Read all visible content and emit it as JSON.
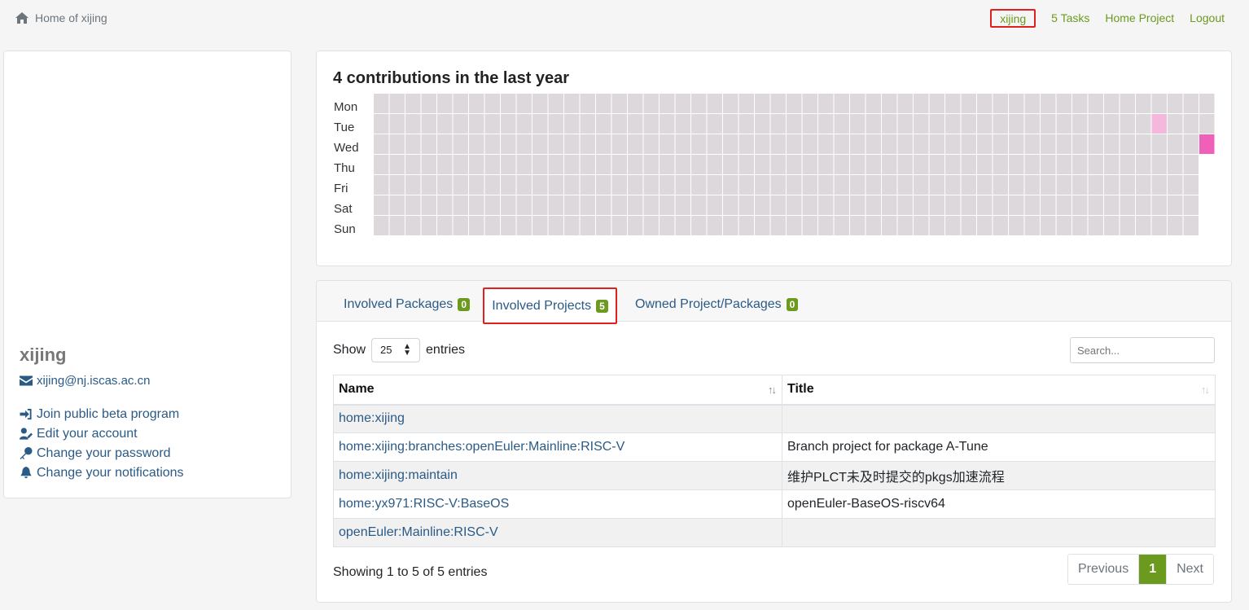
{
  "header": {
    "home_label": "Home of xijing",
    "nav": [
      "xijing",
      "5 Tasks",
      "Home Project",
      "Logout"
    ]
  },
  "profile": {
    "username": "xijing",
    "email": "xijing@nj.iscas.ac.cn",
    "actions": [
      "Join public beta program",
      "Edit your account",
      "Change your password",
      "Change your notifications"
    ]
  },
  "contributions": {
    "title": "4 contributions in the last year",
    "days": [
      "Mon",
      "Tue",
      "Wed",
      "Thu",
      "Fri",
      "Sat",
      "Sun"
    ],
    "colors": {
      "empty": "#ddd8dc",
      "light": "#f4b8dc",
      "dark": "#f060b8"
    }
  },
  "tabs": [
    {
      "label": "Involved Packages",
      "count": "0"
    },
    {
      "label": "Involved Projects",
      "count": "5"
    },
    {
      "label": "Owned Project/Packages",
      "count": "0"
    }
  ],
  "table_controls": {
    "show_label": "Show",
    "entries_label": "entries",
    "page_size": "25",
    "search_placeholder": "Search..."
  },
  "table": {
    "columns": [
      "Name",
      "Title"
    ],
    "rows": [
      {
        "name": "home:xijing",
        "title": ""
      },
      {
        "name": "home:xijing:branches:openEuler:Mainline:RISC-V",
        "title": "Branch project for package A-Tune"
      },
      {
        "name": "home:xijing:maintain",
        "title": "维护PLCT未及时提交的pkgs加速流程"
      },
      {
        "name": "home:yx971:RISC-V:BaseOS",
        "title": "openEuler-BaseOS-riscv64"
      },
      {
        "name": "openEuler:Mainline:RISC-V",
        "title": ""
      }
    ]
  },
  "pagination": {
    "info": "Showing 1 to 5 of 5 entries",
    "previous": "Previous",
    "current": "1",
    "next": "Next"
  }
}
